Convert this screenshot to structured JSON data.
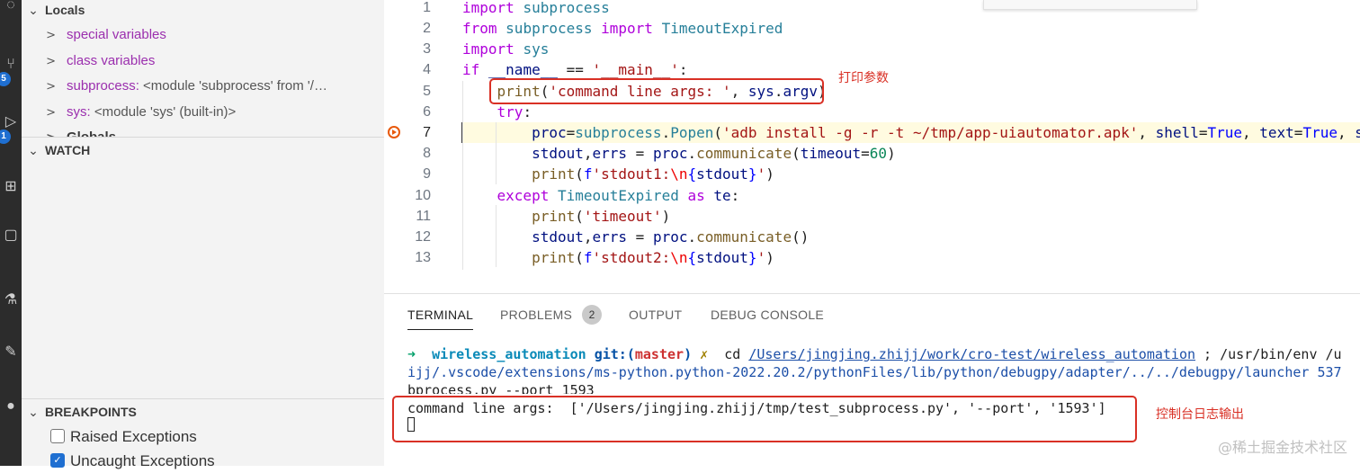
{
  "sidebar": {
    "locals": {
      "title": "Locals",
      "items": [
        {
          "name": "special variables",
          "value": ""
        },
        {
          "name": "class variables",
          "value": ""
        },
        {
          "name": "subprocess:",
          "value": " <module 'subprocess' from '/…"
        },
        {
          "name": "sys:",
          "value": " <module 'sys' (built-in)>"
        }
      ],
      "cut_item": "Globals"
    },
    "watch": {
      "title": "WATCH"
    },
    "breakpoints": {
      "title": "BREAKPOINTS",
      "items": [
        {
          "label": "Raised Exceptions",
          "checked": false
        },
        {
          "label": "Uncaught Exceptions",
          "checked": true
        }
      ]
    }
  },
  "activity_bar": {
    "badges": [
      "5",
      "1"
    ]
  },
  "editor": {
    "line_numbers": [
      "1",
      "2",
      "3",
      "4",
      "5",
      "6",
      "7",
      "8",
      "9",
      "10",
      "11",
      "12",
      "13"
    ],
    "current_line": "7",
    "annotation": "打印参数"
  },
  "panel": {
    "tabs": [
      {
        "label": "TERMINAL",
        "active": true
      },
      {
        "label": "PROBLEMS",
        "active": false,
        "badge": "2"
      },
      {
        "label": "OUTPUT",
        "active": false
      },
      {
        "label": "DEBUG CONSOLE",
        "active": false
      }
    ],
    "terminal": {
      "prompt_arrow": "➜",
      "dir": "wireless_automation",
      "git_label": "git:(",
      "branch": "master",
      "git_close": ")",
      "dirty": "✗",
      "cmd_cd": "cd",
      "cd_path": "/Users/jingjing.zhijj/work/cro-test/wireless_automation",
      "cmd_rest": " ; /usr/bin/env /u",
      "line2": "ijj/.vscode/extensions/ms-python.python-2022.20.2/pythonFiles/lib/python/debugpy/adapter/../../debugpy/launcher 537",
      "line3": "bprocess.py --port 1593",
      "output": "command line args:  ['/Users/jingjing.zhijj/tmp/test_subprocess.py', '--port', '1593']"
    },
    "annotation": "控制台日志输出"
  },
  "watermark": "@稀土掘金技术社区"
}
